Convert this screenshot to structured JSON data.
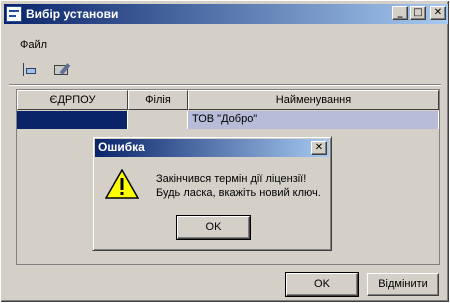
{
  "window": {
    "title": "Вибір установи",
    "min_glyph": "_",
    "max_glyph": "□",
    "close_glyph": "✕"
  },
  "menu": {
    "file_label": "Файл"
  },
  "toolbar": {
    "icons": [
      "tree-view-icon",
      "edit-icon"
    ]
  },
  "grid": {
    "columns": [
      "ЄДРПОУ",
      "Філія",
      "Найменування"
    ],
    "rows": [
      {
        "edrpou": "",
        "filia": "",
        "name": "ТОВ \"Добро\""
      }
    ]
  },
  "buttons": {
    "ok_label": "OK",
    "cancel_label": "Відмінити"
  },
  "error_dialog": {
    "title": "Ошибка",
    "close_glyph": "✕",
    "message_line1": "Закінчився термін дії ліцензії!",
    "message_line2": "Будь ласка, вкажіть новий ключ.",
    "ok_label": "OK",
    "icon": "warning-icon"
  },
  "colors": {
    "titlebar_start": "#0a246a",
    "titlebar_end": "#a6caf0",
    "face": "#d4d0c8",
    "selection": "#0a246a"
  }
}
